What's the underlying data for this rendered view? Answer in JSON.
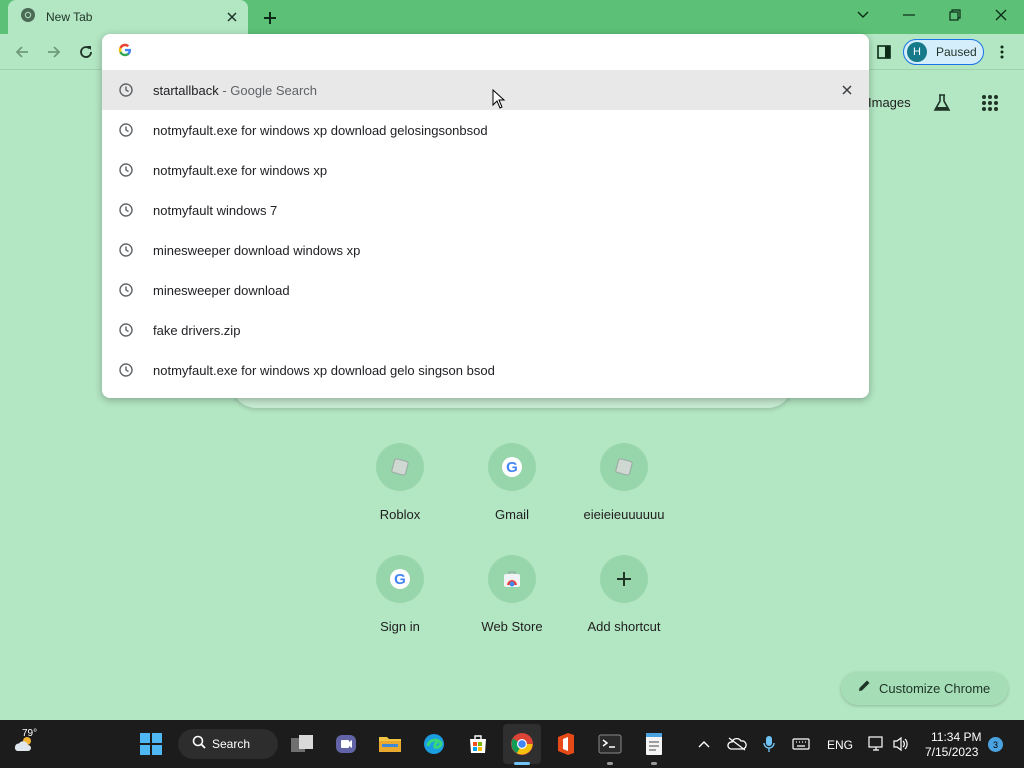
{
  "browser": {
    "tab_title": "New Tab",
    "profile_initial": "H",
    "profile_status": "Paused",
    "omnibox_value": "",
    "colors": {
      "frame": "#5cc176",
      "page": "#b3e6c3",
      "accent": "#1a73e8"
    }
  },
  "suggestions": [
    {
      "text": "startallback",
      "hint": " - Google Search",
      "icon": "history-icon",
      "selected": true
    },
    {
      "text": "notmyfault.exe for windows xp download gelosingsonbsod",
      "icon": "history-icon"
    },
    {
      "text": "notmyfault.exe for windows xp",
      "icon": "history-icon"
    },
    {
      "text": "notmyfault windows 7",
      "icon": "history-icon"
    },
    {
      "text": "minesweeper download windows xp",
      "icon": "history-icon"
    },
    {
      "text": "minesweeper download",
      "icon": "history-icon"
    },
    {
      "text": "fake drivers.zip",
      "icon": "history-icon"
    },
    {
      "text": "notmyfault.exe for windows xp download gelo singson bsod",
      "icon": "history-icon"
    }
  ],
  "page": {
    "images_link": "Images",
    "shortcuts": [
      {
        "label": "Roblox",
        "icon": "roblox-icon"
      },
      {
        "label": "Gmail",
        "icon": "google-icon"
      },
      {
        "label": "eieieieuuuuuu",
        "icon": "roblox-icon"
      },
      {
        "label": "Sign in",
        "icon": "google-icon"
      },
      {
        "label": "Web Store",
        "icon": "webstore-icon"
      },
      {
        "label": "Add shortcut",
        "icon": "plus-icon"
      }
    ],
    "customize_label": "Customize Chrome"
  },
  "taskbar": {
    "weather_temp": "79°",
    "search_label": "Search",
    "language": "ENG",
    "time": "11:34 PM",
    "date": "7/15/2023",
    "notification_count": "3"
  }
}
